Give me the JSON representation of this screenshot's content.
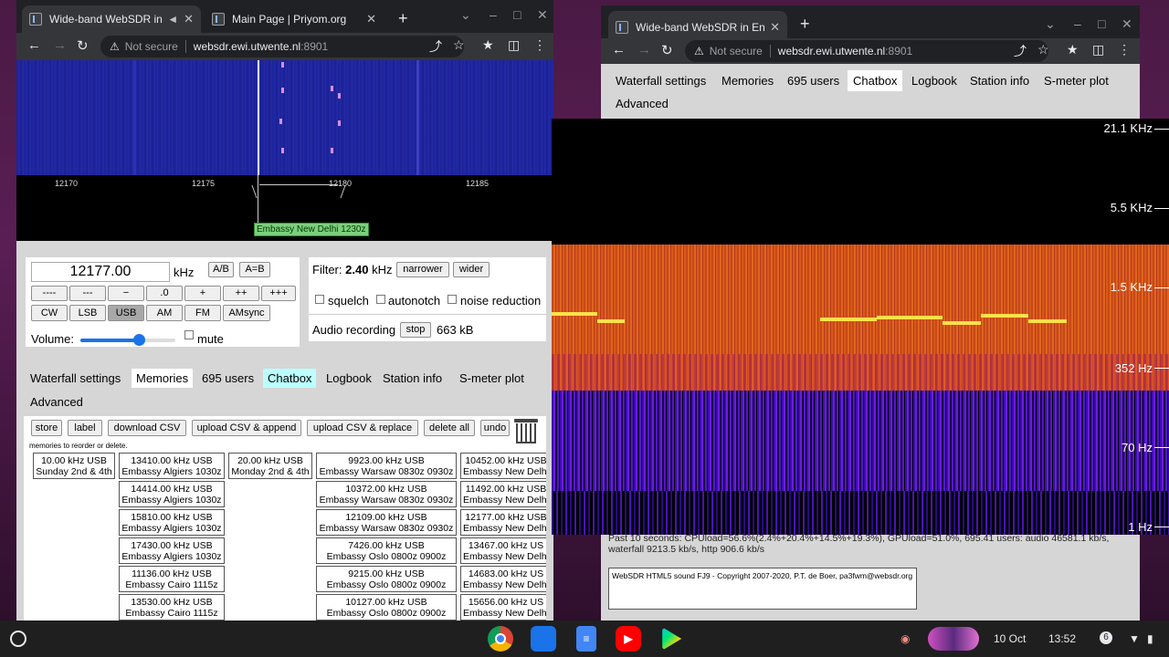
{
  "left_window": {
    "tabs": [
      {
        "title": "Wide-band WebSDR in Ensched",
        "active": true
      },
      {
        "title": "Main Page | Priyom.org",
        "active": false
      }
    ],
    "url_warning": "Not secure",
    "url_host": "websdr.ewi.utwente.nl",
    "url_port": ":8901",
    "scale_ticks": [
      "12170",
      "12175",
      "12180",
      "12185"
    ],
    "station_label": "Embassy New Delhi 1230z",
    "frequency_value": "12177.00",
    "frequency_unit": "kHz",
    "ab_button": "A/B",
    "aeqb_button": "A=B",
    "step_buttons": [
      "----",
      "---",
      "−",
      ".0",
      "+",
      "++",
      "+++"
    ],
    "mode_buttons": [
      "CW",
      "LSB",
      "USB",
      "AM",
      "FM",
      "AMsync"
    ],
    "active_mode": "USB",
    "volume_label": "Volume:",
    "volume_level": 0.62,
    "mute_label": "mute",
    "filter_label": "Filter:",
    "filter_value": "2.40",
    "filter_unit": "kHz",
    "narrower_button": "narrower",
    "wider_button": "wider",
    "squelch_label": "squelch",
    "autonotch_label": "autonotch",
    "noise_reduction_label": "noise reduction",
    "audio_recording_label": "Audio recording",
    "stop_button": "stop",
    "recording_size": "663 kB",
    "page_tabs": [
      "Waterfall settings",
      "Memories",
      "695 users",
      "Chatbox",
      "Logbook",
      "Station info",
      "S-meter plot",
      "Advanced"
    ],
    "memory_buttons": [
      "store",
      "label",
      "download CSV",
      "upload CSV & append",
      "upload CSV & replace",
      "delete all",
      "undo"
    ],
    "memory_note": "memories to reorder or delete.",
    "memories_col1": [
      {
        "freq": "10.00 kHz USB",
        "name": "Sunday 2nd & 4th"
      }
    ],
    "memories_col2": [
      {
        "freq": "13410.00 kHz USB",
        "name": "Embassy Algiers 1030z"
      },
      {
        "freq": "14414.00 kHz USB",
        "name": "Embassy Algiers 1030z"
      },
      {
        "freq": "15810.00 kHz USB",
        "name": "Embassy Algiers 1030z"
      },
      {
        "freq": "17430.00 kHz USB",
        "name": "Embassy Algiers 1030z"
      },
      {
        "freq": "11136.00 kHz USB",
        "name": "Embassy Cairo 1115z"
      },
      {
        "freq": "13530.00 kHz USB",
        "name": "Embassy Cairo 1115z"
      }
    ],
    "memories_col3": [
      {
        "freq": "20.00 kHz USB",
        "name": "Monday 2nd & 4th"
      }
    ],
    "memories_col4": [
      {
        "freq": "9923.00 kHz USB",
        "name": "Embassy Warsaw 0830z 0930z"
      },
      {
        "freq": "10372.00 kHz USB",
        "name": "Embassy Warsaw 0830z 0930z"
      },
      {
        "freq": "12109.00 kHz USB",
        "name": "Embassy Warsaw 0830z 0930z"
      },
      {
        "freq": "7426.00 kHz USB",
        "name": "Embassy Oslo 0800z 0900z"
      },
      {
        "freq": "9215.00 kHz USB",
        "name": "Embassy Oslo 0800z 0900z"
      },
      {
        "freq": "10127.00 kHz USB",
        "name": "Embassy Oslo 0800z 0900z"
      }
    ],
    "memories_col5": [
      {
        "freq": "10452.00 kHz USB",
        "name": "Embassy New Delhi"
      },
      {
        "freq": "11492.00 kHz USB",
        "name": "Embassy New Delhi"
      },
      {
        "freq": "12177.00 kHz USB",
        "name": "Embassy New Delhi"
      },
      {
        "freq": "13467.00 kHz US",
        "name": "Embassy New Delhi"
      },
      {
        "freq": "14683.00 kHz US",
        "name": "Embassy New Delhi"
      },
      {
        "freq": "15656.00 kHz US",
        "name": "Embassy New Delhi"
      }
    ]
  },
  "right_window": {
    "tab_title": "Wide-band WebSDR in Ensched",
    "url_warning": "Not secure",
    "url_host": "websdr.ewi.utwente.nl",
    "url_port": ":8901",
    "page_tabs": [
      "Waterfall settings",
      "Memories",
      "695 users",
      "Chatbox",
      "Logbook",
      "Station info",
      "S-meter plot",
      "Advanced"
    ],
    "selected_tab": "Chatbox",
    "spectrogram_labels": [
      "21.1 KHz",
      "5.5 KHz",
      "1.5 KHz",
      "352 Hz",
      "70 Hz",
      "1 Hz"
    ],
    "status_line1": "Past 10 seconds: CPUload=56.6%(2.4%+20.4%+14.5%+19.3%), GPUload=51.0%, 695.41 users: audio 46581.1 kb/s,",
    "status_line2": "waterfall 9213.5 kb/s, http 906.6 kb/s",
    "credit": "WebSDR HTML5 sound FJ9 - Copyright 2007-2020, P.T. de Boer, pa3fwm@websdr.org"
  },
  "shelf": {
    "date": "10 Oct",
    "time": "13:52",
    "notification_count": "6",
    "apps": [
      "chrome-icon",
      "files-icon",
      "docs-icon",
      "youtube-icon",
      "play-store-icon"
    ]
  },
  "colors": {
    "waterfall_blue": "#1c2198",
    "signal_pink": "#d58ef2",
    "station_green": "#7cd07c",
    "tab_highlight": "#bbffff",
    "spectrogram_orange": "#e0661c",
    "spectrogram_purple": "#6a1ce0",
    "tone_yellow": "#ffe14a"
  }
}
